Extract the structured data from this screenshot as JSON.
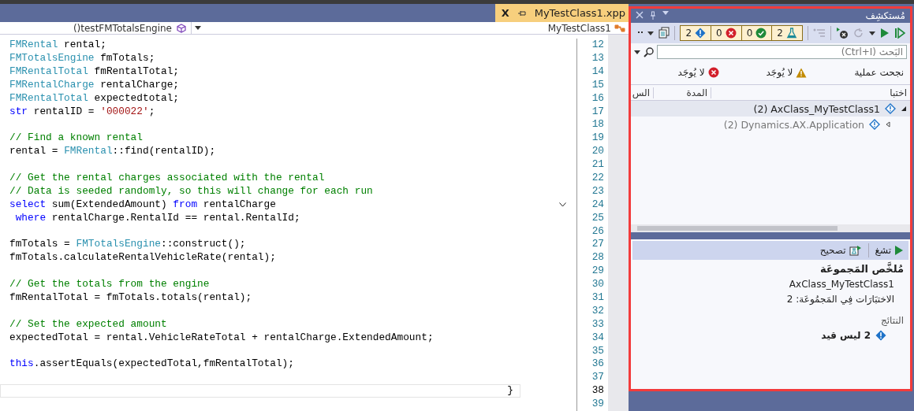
{
  "editor": {
    "tab": {
      "title": "MyTestClass1.xpp",
      "close": "X",
      "selected": true
    },
    "nav": {
      "member": "()testFMTotalsEngine",
      "class": "MyTestClass1"
    },
    "lines": [
      {
        "number": "12",
        "current": false,
        "tokens": [
          {
            "kind": "type",
            "t": "FMRental"
          },
          {
            "kind": "plain",
            "t": " rental;"
          }
        ]
      },
      {
        "number": "13",
        "current": false,
        "tokens": [
          {
            "kind": "type",
            "t": "FMTotalsEngine"
          },
          {
            "kind": "plain",
            "t": " fmTotals;"
          }
        ]
      },
      {
        "number": "14",
        "current": false,
        "tokens": [
          {
            "kind": "type",
            "t": "FMRentalTotal"
          },
          {
            "kind": "plain",
            "t": " fmRentalTotal;"
          }
        ]
      },
      {
        "number": "15",
        "current": false,
        "tokens": [
          {
            "kind": "type",
            "t": "FMRentalCharge"
          },
          {
            "kind": "plain",
            "t": " rentalCharge;"
          }
        ]
      },
      {
        "number": "16",
        "current": false,
        "tokens": [
          {
            "kind": "type",
            "t": "FMRentalTotal"
          },
          {
            "kind": "plain",
            "t": " expectedtotal;"
          }
        ]
      },
      {
        "number": "17",
        "current": false,
        "tokens": [
          {
            "kind": "keyword",
            "t": "str"
          },
          {
            "kind": "plain",
            "t": " rentalID = "
          },
          {
            "kind": "string",
            "t": "'000022'"
          },
          {
            "kind": "plain",
            "t": ";"
          }
        ]
      },
      {
        "number": "18",
        "current": false
      },
      {
        "number": "19",
        "current": false,
        "tokens": [
          {
            "kind": "comment",
            "t": "// Find a known rental"
          }
        ]
      },
      {
        "number": "20",
        "current": false,
        "tokens": [
          {
            "kind": "plain",
            "t": "rental = "
          },
          {
            "kind": "type",
            "t": "FMRental"
          },
          {
            "kind": "plain",
            "t": "::find(rentalID);"
          }
        ]
      },
      {
        "number": "21",
        "current": false
      },
      {
        "number": "22",
        "current": false,
        "tokens": [
          {
            "kind": "comment",
            "t": "// Get the rental charges associated with the rental"
          }
        ]
      },
      {
        "number": "23",
        "current": false,
        "tokens": [
          {
            "kind": "comment",
            "t": "// Data is seeded randomly, so this will change for each run"
          }
        ]
      },
      {
        "number": "24",
        "current": false,
        "fold": true,
        "tokens": [
          {
            "kind": "keyword",
            "t": "select"
          },
          {
            "kind": "plain",
            "t": " sum(ExtendedAmount) "
          },
          {
            "kind": "keyword",
            "t": "from"
          },
          {
            "kind": "plain",
            "t": " rentalCharge"
          }
        ]
      },
      {
        "number": "25",
        "current": false,
        "tokens": [
          {
            "kind": "keyword",
            "t": " where"
          },
          {
            "kind": "plain",
            "t": " rentalCharge.RentalId == rental.RentalId;"
          }
        ]
      },
      {
        "number": "26",
        "current": false
      },
      {
        "number": "27",
        "current": false,
        "tokens": [
          {
            "kind": "plain",
            "t": "fmTotals = "
          },
          {
            "kind": "type",
            "t": "FMTotalsEngine"
          },
          {
            "kind": "plain",
            "t": "::construct();"
          }
        ]
      },
      {
        "number": "28",
        "current": false,
        "tokens": [
          {
            "kind": "plain",
            "t": "fmTotals.calculateRentalVehicleRate(rental);"
          }
        ]
      },
      {
        "number": "29",
        "current": false
      },
      {
        "number": "30",
        "current": false,
        "tokens": [
          {
            "kind": "comment",
            "t": "// Get the totals from the engine"
          }
        ]
      },
      {
        "number": "31",
        "current": false,
        "tokens": [
          {
            "kind": "plain",
            "t": "fmRentalTotal = fmTotals.totals(rental);"
          }
        ]
      },
      {
        "number": "32",
        "current": false
      },
      {
        "number": "33",
        "current": false,
        "tokens": [
          {
            "kind": "comment",
            "t": "// Set the expected amount"
          }
        ]
      },
      {
        "number": "34",
        "current": false,
        "tokens": [
          {
            "kind": "plain",
            "t": "expectedTotal = rental.VehicleRateTotal + rentalCharge.ExtendedAmount;"
          }
        ]
      },
      {
        "number": "35",
        "current": false
      },
      {
        "number": "36",
        "current": false,
        "tokens": [
          {
            "kind": "keyword",
            "t": "this"
          },
          {
            "kind": "plain",
            "t": ".assertEquals(expectedTotal,fmRentalTotal);"
          }
        ]
      },
      {
        "number": "37",
        "current": false
      },
      {
        "number": "38",
        "current": true,
        "tokens": [
          {
            "kind": "plain",
            "t": "}"
          }
        ]
      },
      {
        "number": "39",
        "current": false
      }
    ]
  },
  "test_explorer": {
    "title": "مُستكشِف",
    "counters": [
      {
        "kind": "not_run",
        "count": "2"
      },
      {
        "kind": "failed",
        "count": "0"
      },
      {
        "kind": "passed",
        "count": "0"
      },
      {
        "kind": "tests",
        "count": "2"
      }
    ],
    "search": {
      "placeholder": "البَحث (Ctrl+I)"
    },
    "summary": [
      {
        "kind": "passed",
        "label": "نجحت عملية"
      },
      {
        "kind": "warning",
        "label": "لا يُوجَد"
      },
      {
        "kind": "error",
        "label": "لا يُوجَد"
      }
    ],
    "columns": [
      "اختبا",
      "المدة",
      "الس"
    ],
    "tree": [
      {
        "label": "(2) AxClass_MyTestClass1",
        "expanded": true,
        "selected": true,
        "children": [
          {
            "label": "(2) Dynamics.AX.Application",
            "expanded": false,
            "selected": false
          }
        ]
      }
    ],
    "details": {
      "actions": [
        {
          "kind": "run",
          "label": "تشغ"
        },
        {
          "kind": "debug",
          "label": "تصحيح"
        }
      ],
      "heading": "مُلخَّص المَجموعَة",
      "group": "AxClass_MyTestClass1",
      "count": "الاختبَارَات فِي المَجمُوعَة: 2",
      "results_label": "النتائج",
      "results": [
        {
          "kind": "not_run",
          "label": "2 ليس قيد"
        }
      ]
    }
  }
}
